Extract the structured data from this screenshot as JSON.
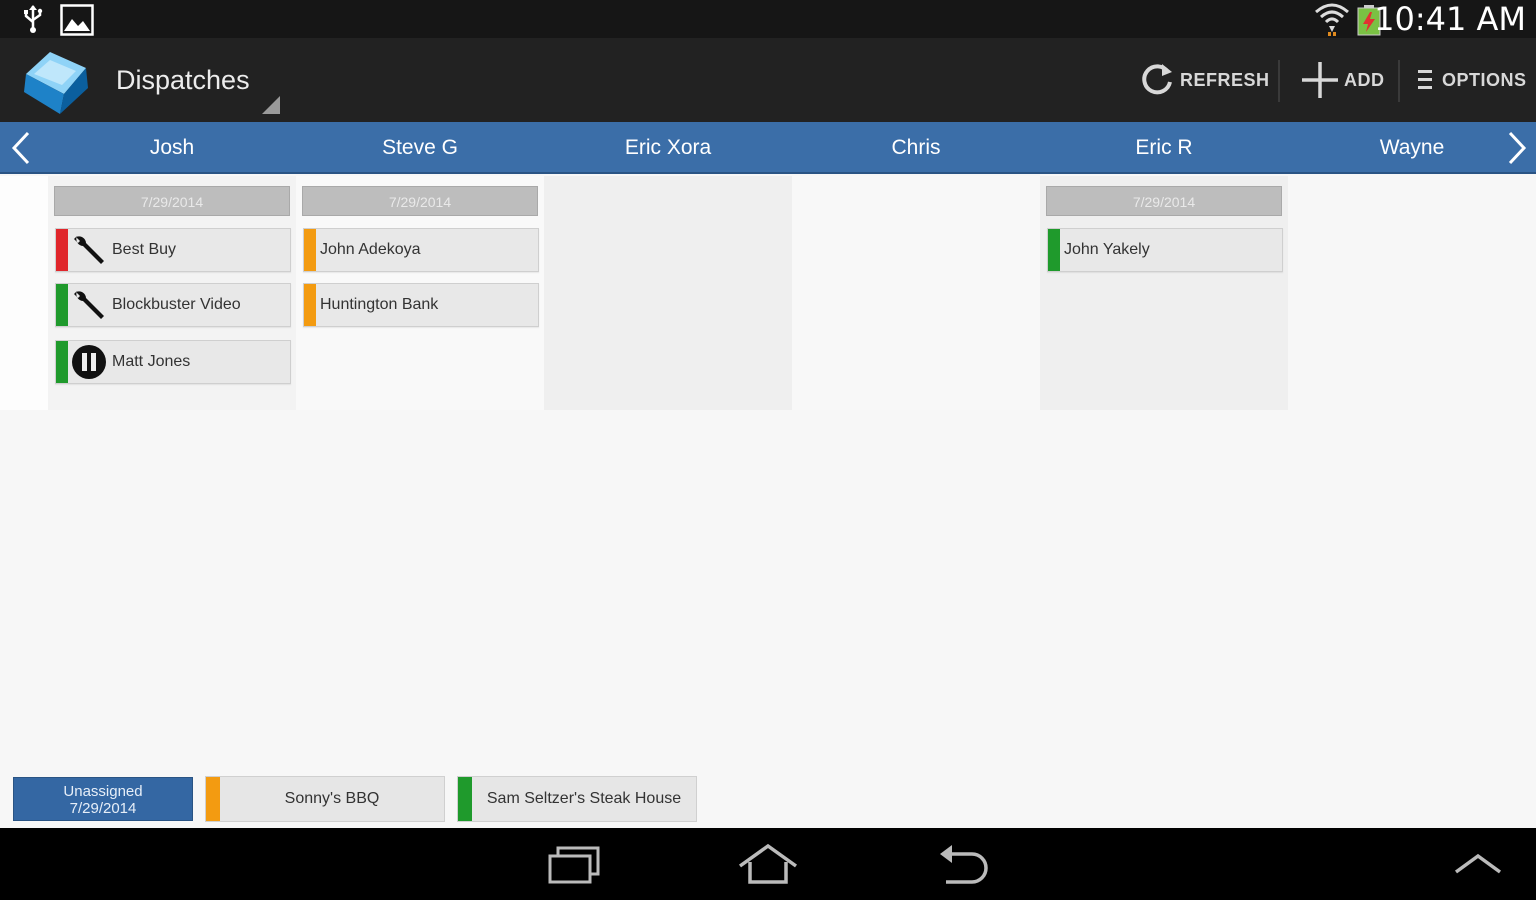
{
  "status_bar": {
    "time": "10:41 AM",
    "icons": [
      "usb-icon",
      "image-icon",
      "wifi-icon",
      "battery-icon"
    ]
  },
  "action_bar": {
    "title": "Dispatches",
    "actions": {
      "refresh": "REFRESH",
      "add": "ADD",
      "options": "OPTIONS"
    }
  },
  "assignees": [
    "Josh",
    "Steve G",
    "Eric Xora",
    "Chris",
    "Eric R",
    "Wayne"
  ],
  "columns": {
    "josh": {
      "date": "7/29/2014",
      "cards": [
        {
          "label": "Best Buy",
          "status_color": "#e0262b",
          "icon": "wrench-icon"
        },
        {
          "label": "Blockbuster Video",
          "status_color": "#1f9a2c",
          "icon": "wrench-icon"
        },
        {
          "label": "Matt Jones",
          "status_color": "#1f9a2c",
          "icon": "pause-icon"
        }
      ]
    },
    "steve_g": {
      "date": "7/29/2014",
      "cards": [
        {
          "label": "John Adekoya",
          "status_color": "#f39b11"
        },
        {
          "label": "Huntington Bank",
          "status_color": "#f39b11"
        }
      ]
    },
    "eric_r": {
      "date": "7/29/2014",
      "cards": [
        {
          "label": "John Yakely",
          "status_color": "#1f9a2c"
        }
      ]
    }
  },
  "unassigned": {
    "title": "Unassigned",
    "date": "7/29/2014",
    "cards": [
      {
        "label": "Sonny's BBQ",
        "status_color": "#f39b11"
      },
      {
        "label": "Sam Seltzer's Steak House",
        "status_color": "#1f9a2c"
      }
    ]
  },
  "colors": {
    "header_blue": "#3b6ea8",
    "action_bar": "#222222",
    "status_red": "#e0262b",
    "status_green": "#1f9a2c",
    "status_orange": "#f39b11"
  }
}
